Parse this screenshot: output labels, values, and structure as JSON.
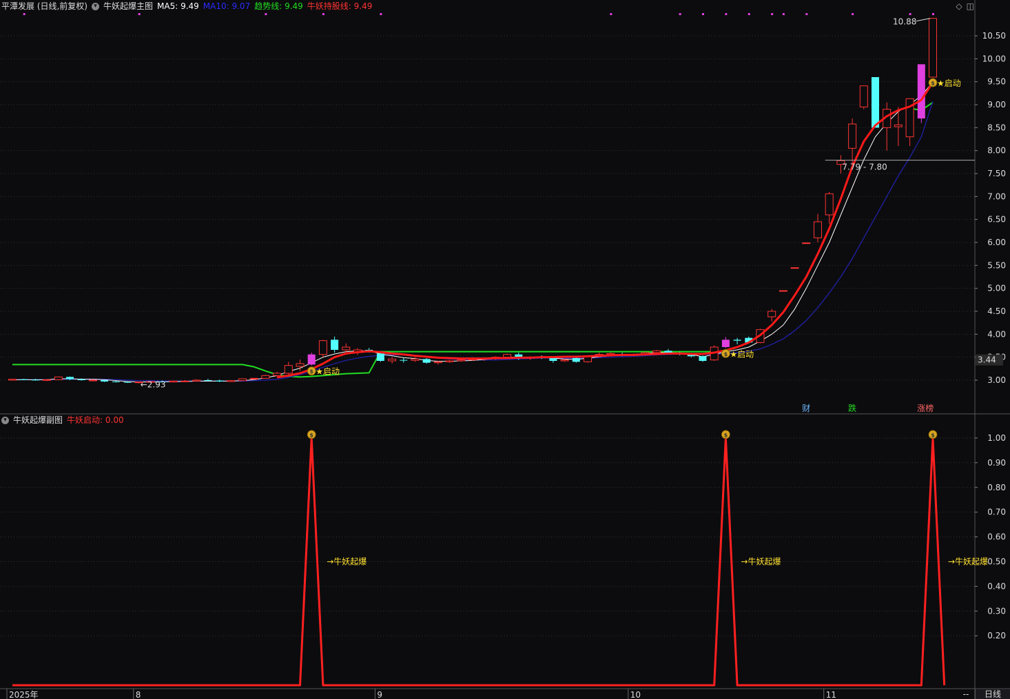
{
  "main_legend": {
    "stock_title": "平潭发展 (日线,前复权)",
    "indicator_name": "牛妖起爆主图",
    "ma5_label": "MA5: 9.49",
    "ma10_label": "MA10: 9.07",
    "trend_label": "趋势线: 9.49",
    "hold_label": "牛妖持股线: 9.49"
  },
  "sub_legend": {
    "indicator_name": "牛妖起爆副图",
    "start_label": "牛妖启动: 0.00"
  },
  "top_icons": {
    "diamond": "◇",
    "window": "◫"
  },
  "colors": {
    "up": "#ff3333",
    "down": "#54ffff",
    "ma5": "#ffffff",
    "ma10": "#1f1fa0",
    "trend": "#22dd22",
    "hold": "#ff1a1a",
    "signal": "#ff2020",
    "signal_dot": "#e040e0",
    "grid": "#2a2a2a",
    "text": "#dddddd",
    "yellow": "#ffe030"
  },
  "x_axis": {
    "labels": [
      {
        "text": "2025年",
        "index": 0
      },
      {
        "text": "8",
        "index": 11
      },
      {
        "text": "9",
        "index": 32
      },
      {
        "text": "10",
        "index": 54
      },
      {
        "text": "11",
        "index": 71
      }
    ],
    "dash_label": "--",
    "timeframe_label": "日线"
  },
  "annotations": {
    "max_label": "10.88",
    "min_label": "←2.93",
    "range_label": "7.79 - 7.80",
    "last_price_label": "3.44",
    "start_label": "★启动",
    "explode_label": "→牛妖起爆",
    "money_icon": "money-bag-icon",
    "events": [
      {
        "text": "财",
        "index": 69,
        "color": "#6fb6ff"
      },
      {
        "text": "跌",
        "index": 73,
        "color": "#22dd22"
      },
      {
        "text": "涨榜",
        "index": 79,
        "color": "#ff6666"
      }
    ]
  },
  "chart_data": [
    {
      "type": "candlestick",
      "title": "平潭发展 (日线,前复权)",
      "ylim": [
        2.7,
        10.95
      ],
      "yticks": [
        3.0,
        3.5,
        4.0,
        4.5,
        5.0,
        5.5,
        6.0,
        6.5,
        7.0,
        7.5,
        8.0,
        8.5,
        9.0,
        9.5,
        10.0,
        10.5
      ],
      "ytick_labels": [
        "3.00",
        "3.50",
        "4.00",
        "4.50",
        "5.00",
        "5.50",
        "6.00",
        "6.50",
        "7.00",
        "7.50",
        "8.00",
        "8.50",
        "9.00",
        "9.50",
        "10.00",
        "10.50"
      ],
      "candles": [
        [
          3.0,
          3.02,
          2.99,
          3.02
        ],
        [
          3.02,
          3.03,
          3.0,
          3.01
        ],
        [
          3.01,
          3.03,
          2.99,
          3.0
        ],
        [
          3.0,
          3.02,
          2.98,
          3.01
        ],
        [
          3.01,
          3.08,
          3.0,
          3.07
        ],
        [
          3.07,
          3.08,
          3.0,
          3.02
        ],
        [
          3.02,
          3.04,
          2.99,
          3.0
        ],
        [
          3.0,
          3.02,
          2.98,
          3.0
        ],
        [
          3.0,
          3.01,
          2.96,
          2.97
        ],
        [
          2.97,
          2.99,
          2.95,
          2.96
        ],
        [
          2.96,
          2.98,
          2.94,
          2.95
        ],
        [
          2.95,
          2.97,
          2.93,
          2.96
        ],
        [
          2.96,
          2.98,
          2.94,
          2.97
        ],
        [
          2.97,
          2.99,
          2.95,
          2.96
        ],
        [
          2.96,
          2.99,
          2.95,
          2.98
        ],
        [
          2.98,
          3.0,
          2.96,
          2.98
        ],
        [
          2.98,
          3.02,
          2.97,
          3.0
        ],
        [
          3.0,
          3.03,
          2.98,
          2.99
        ],
        [
          2.99,
          3.01,
          2.96,
          2.97
        ],
        [
          2.97,
          3.0,
          2.96,
          2.99
        ],
        [
          2.99,
          3.04,
          2.98,
          3.03
        ],
        [
          3.03,
          3.05,
          3.0,
          3.04
        ],
        [
          3.04,
          3.12,
          3.03,
          3.1
        ],
        [
          3.1,
          3.18,
          3.08,
          3.15
        ],
        [
          3.15,
          3.4,
          3.1,
          3.32
        ],
        [
          3.3,
          3.45,
          3.2,
          3.36
        ],
        [
          3.34,
          3.6,
          3.32,
          3.56
        ],
        [
          3.56,
          3.88,
          3.5,
          3.86
        ],
        [
          3.88,
          3.95,
          3.6,
          3.66
        ],
        [
          3.66,
          3.8,
          3.58,
          3.72
        ],
        [
          3.6,
          3.7,
          3.55,
          3.66
        ],
        [
          3.66,
          3.7,
          3.6,
          3.64
        ],
        [
          3.58,
          3.6,
          3.4,
          3.42
        ],
        [
          3.42,
          3.5,
          3.36,
          3.46
        ],
        [
          3.44,
          3.48,
          3.38,
          3.43
        ],
        [
          3.43,
          3.5,
          3.4,
          3.46
        ],
        [
          3.46,
          3.48,
          3.36,
          3.38
        ],
        [
          3.38,
          3.42,
          3.34,
          3.4
        ],
        [
          3.4,
          3.44,
          3.38,
          3.42
        ],
        [
          3.42,
          3.46,
          3.4,
          3.44
        ],
        [
          3.44,
          3.5,
          3.42,
          3.46
        ],
        [
          3.46,
          3.5,
          3.42,
          3.48
        ],
        [
          3.48,
          3.52,
          3.44,
          3.5
        ],
        [
          3.5,
          3.58,
          3.48,
          3.56
        ],
        [
          3.56,
          3.6,
          3.44,
          3.48
        ],
        [
          3.48,
          3.52,
          3.44,
          3.5
        ],
        [
          3.5,
          3.54,
          3.46,
          3.48
        ],
        [
          3.48,
          3.5,
          3.38,
          3.42
        ],
        [
          3.42,
          3.46,
          3.4,
          3.44
        ],
        [
          3.48,
          3.5,
          3.38,
          3.4
        ],
        [
          3.4,
          3.54,
          3.38,
          3.52
        ],
        [
          3.52,
          3.6,
          3.5,
          3.56
        ],
        [
          3.56,
          3.6,
          3.54,
          3.58
        ],
        [
          3.56,
          3.6,
          3.52,
          3.54
        ],
        [
          3.54,
          3.58,
          3.52,
          3.56
        ],
        [
          3.56,
          3.62,
          3.54,
          3.6
        ],
        [
          3.6,
          3.66,
          3.58,
          3.64
        ],
        [
          3.64,
          3.68,
          3.56,
          3.58
        ],
        [
          3.58,
          3.62,
          3.54,
          3.56
        ],
        [
          3.56,
          3.58,
          3.5,
          3.52
        ],
        [
          3.52,
          3.54,
          3.4,
          3.42
        ],
        [
          3.44,
          3.76,
          3.42,
          3.72
        ],
        [
          3.72,
          3.94,
          3.7,
          3.88
        ],
        [
          3.88,
          3.92,
          3.78,
          3.86
        ],
        [
          3.92,
          3.95,
          3.8,
          3.82
        ],
        [
          3.82,
          4.12,
          3.8,
          4.1
        ],
        [
          4.38,
          4.55,
          4.28,
          4.5
        ],
        [
          4.95,
          4.95,
          4.95,
          4.95
        ],
        [
          5.45,
          5.45,
          5.45,
          5.45
        ],
        [
          5.99,
          5.99,
          5.99,
          5.99
        ],
        [
          6.1,
          6.62,
          6.0,
          6.45
        ],
        [
          6.6,
          7.1,
          6.4,
          7.06
        ],
        [
          7.7,
          7.9,
          7.5,
          7.78
        ],
        [
          8.05,
          8.7,
          7.7,
          8.58
        ],
        [
          8.95,
          9.41,
          8.9,
          9.41
        ],
        [
          9.6,
          9.6,
          8.5,
          8.5
        ],
        [
          8.5,
          9.05,
          8.0,
          8.9
        ],
        [
          8.52,
          8.95,
          8.1,
          8.56
        ],
        [
          8.3,
          9.13,
          8.1,
          9.13
        ],
        [
          8.7,
          9.7,
          8.6,
          9.88
        ],
        [
          9.6,
          10.88,
          9.6,
          10.88
        ]
      ],
      "ma5": [
        3.01,
        3.01,
        3.01,
        3.01,
        3.03,
        3.03,
        3.02,
        3.02,
        3.01,
        2.99,
        2.97,
        2.96,
        2.96,
        2.96,
        2.97,
        2.97,
        2.98,
        2.98,
        2.98,
        2.98,
        2.99,
        3.01,
        3.05,
        3.1,
        3.19,
        3.26,
        3.38,
        3.5,
        3.57,
        3.62,
        3.64,
        3.64,
        3.57,
        3.53,
        3.49,
        3.47,
        3.43,
        3.41,
        3.41,
        3.42,
        3.43,
        3.45,
        3.47,
        3.5,
        3.5,
        3.5,
        3.5,
        3.48,
        3.46,
        3.45,
        3.48,
        3.51,
        3.53,
        3.54,
        3.56,
        3.58,
        3.6,
        3.6,
        3.59,
        3.56,
        3.51,
        3.56,
        3.62,
        3.66,
        3.72,
        3.85,
        4.0,
        4.2,
        4.55,
        5.0,
        5.5,
        6.0,
        6.6,
        7.2,
        7.8,
        8.3,
        8.6,
        8.85,
        9.0,
        9.2,
        9.49
      ],
      "ma10": [
        3.01,
        3.01,
        3.01,
        3.01,
        3.02,
        3.02,
        3.02,
        3.02,
        3.02,
        3.01,
        3.0,
        2.99,
        2.99,
        2.98,
        2.98,
        2.98,
        2.98,
        2.98,
        2.98,
        2.98,
        2.98,
        2.99,
        3.0,
        3.02,
        3.06,
        3.12,
        3.19,
        3.28,
        3.36,
        3.43,
        3.48,
        3.52,
        3.54,
        3.55,
        3.55,
        3.54,
        3.51,
        3.48,
        3.46,
        3.45,
        3.44,
        3.44,
        3.44,
        3.45,
        3.46,
        3.47,
        3.48,
        3.48,
        3.48,
        3.48,
        3.48,
        3.49,
        3.5,
        3.51,
        3.52,
        3.53,
        3.55,
        3.56,
        3.57,
        3.57,
        3.56,
        3.56,
        3.58,
        3.6,
        3.63,
        3.68,
        3.78,
        3.9,
        4.08,
        4.3,
        4.58,
        4.9,
        5.25,
        5.65,
        6.1,
        6.55,
        7.0,
        7.45,
        7.85,
        8.3,
        9.07
      ],
      "trend": [
        3.34,
        3.34,
        3.34,
        3.34,
        3.34,
        3.34,
        3.34,
        3.34,
        3.34,
        3.34,
        3.34,
        3.34,
        3.34,
        3.34,
        3.34,
        3.34,
        3.34,
        3.34,
        3.34,
        3.34,
        3.34,
        3.29,
        3.2,
        3.12,
        3.08,
        3.07,
        3.08,
        3.1,
        3.12,
        3.14,
        3.15,
        3.16,
        3.62,
        3.62,
        3.62,
        3.62,
        3.62,
        3.62,
        3.62,
        3.62,
        3.62,
        3.62,
        3.62,
        3.62,
        3.62,
        3.62,
        3.62,
        3.62,
        3.62,
        3.62,
        3.62,
        3.62,
        3.62,
        3.62,
        3.62,
        3.62,
        3.62,
        3.62,
        3.62,
        3.62,
        3.62,
        3.62,
        null,
        null,
        null,
        null,
        null,
        null,
        null,
        null,
        null,
        null,
        null,
        null,
        null,
        null,
        null,
        null,
        8.92,
        8.88,
        9.05
      ],
      "hold": [
        null,
        null,
        null,
        null,
        null,
        null,
        null,
        null,
        null,
        null,
        null,
        null,
        null,
        null,
        null,
        null,
        null,
        null,
        null,
        null,
        null,
        null,
        null,
        3.06,
        3.1,
        3.15,
        3.24,
        3.36,
        3.5,
        3.58,
        3.61,
        3.63,
        3.61,
        3.58,
        3.56,
        3.53,
        3.51,
        3.49,
        3.48,
        3.47,
        3.47,
        3.47,
        3.48,
        3.48,
        3.49,
        3.49,
        3.5,
        3.5,
        3.51,
        3.51,
        3.52,
        3.53,
        3.54,
        3.55,
        3.55,
        3.56,
        3.57,
        3.58,
        3.58,
        3.57,
        3.57,
        3.6,
        3.65,
        3.72,
        3.82,
        3.98,
        4.2,
        4.48,
        4.85,
        5.25,
        5.75,
        6.3,
        6.95,
        7.65,
        8.2,
        8.55,
        8.75,
        8.88,
        8.96,
        9.1,
        9.49
      ],
      "start_signals": [
        26,
        62,
        80
      ],
      "range_line_value": 7.79,
      "last_price": 3.44
    },
    {
      "type": "line",
      "title": "牛妖起爆副图",
      "series": [
        {
          "name": "牛妖启动",
          "values": [
            0,
            0,
            0,
            0,
            0,
            0,
            0,
            0,
            0,
            0,
            0,
            0,
            0,
            0,
            0,
            0,
            0,
            0,
            0,
            0,
            0,
            0,
            0,
            0,
            0,
            0,
            1,
            0,
            0,
            0,
            0,
            0,
            0,
            0,
            0,
            0,
            0,
            0,
            0,
            0,
            0,
            0,
            0,
            0,
            0,
            0,
            0,
            0,
            0,
            0,
            0,
            0,
            0,
            0,
            0,
            0,
            0,
            0,
            0,
            0,
            0,
            0,
            1,
            0,
            0,
            0,
            0,
            0,
            0,
            0,
            0,
            0,
            0,
            0,
            0,
            0,
            0,
            0,
            0,
            0,
            1,
            0
          ]
        }
      ],
      "ylim": [
        0,
        1.05
      ],
      "yticks": [
        0.2,
        0.3,
        0.4,
        0.5,
        0.6,
        0.7,
        0.8,
        0.9,
        1.0
      ],
      "ytick_labels": [
        "0.20",
        "0.30",
        "0.40",
        "0.50",
        "0.60",
        "0.70",
        "0.80",
        "0.90",
        "1.00"
      ]
    }
  ]
}
